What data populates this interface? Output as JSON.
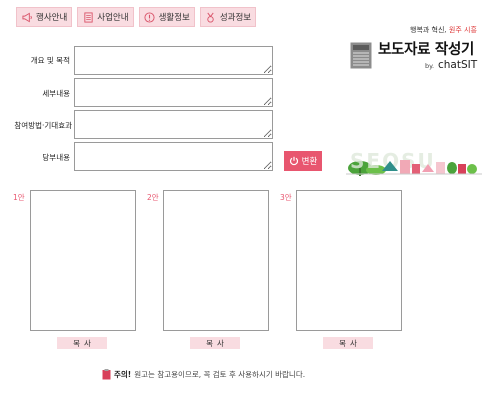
{
  "nav": {
    "tabs": [
      {
        "label": "행사안내",
        "icon": "megaphone-icon"
      },
      {
        "label": "사업안내",
        "icon": "document-list-icon"
      },
      {
        "label": "생활정보",
        "icon": "info-icon"
      },
      {
        "label": "성과정보",
        "icon": "medal-icon"
      }
    ]
  },
  "brand": {
    "slogan_black": "행복과 혁신,",
    "slogan_red": "원주",
    "slogan_end": "시흥",
    "title": "보도자료 작성기",
    "by": "by.",
    "chatsit": "chatSIT"
  },
  "form": {
    "fields": [
      {
        "label": "개요 및 목적",
        "value": ""
      },
      {
        "label": "세부내용",
        "value": ""
      },
      {
        "label": "참여방법·기대효과",
        "value": ""
      },
      {
        "label": "당부내용",
        "value": ""
      }
    ],
    "convert_label": "변환"
  },
  "drafts": [
    {
      "number": "1안",
      "content": "",
      "copy_label": "복사"
    },
    {
      "number": "2안",
      "content": "",
      "copy_label": "복사"
    },
    {
      "number": "3안",
      "content": "",
      "copy_label": "복사"
    }
  ],
  "notice": {
    "bold": "주의!",
    "text": "원고는 참고용이므로, 꼭 검토 후 사용하시기 바랍니다."
  },
  "colors": {
    "accent": "#e8566f",
    "tab_bg": "#f9dce1",
    "border": "#9a9a9a"
  }
}
